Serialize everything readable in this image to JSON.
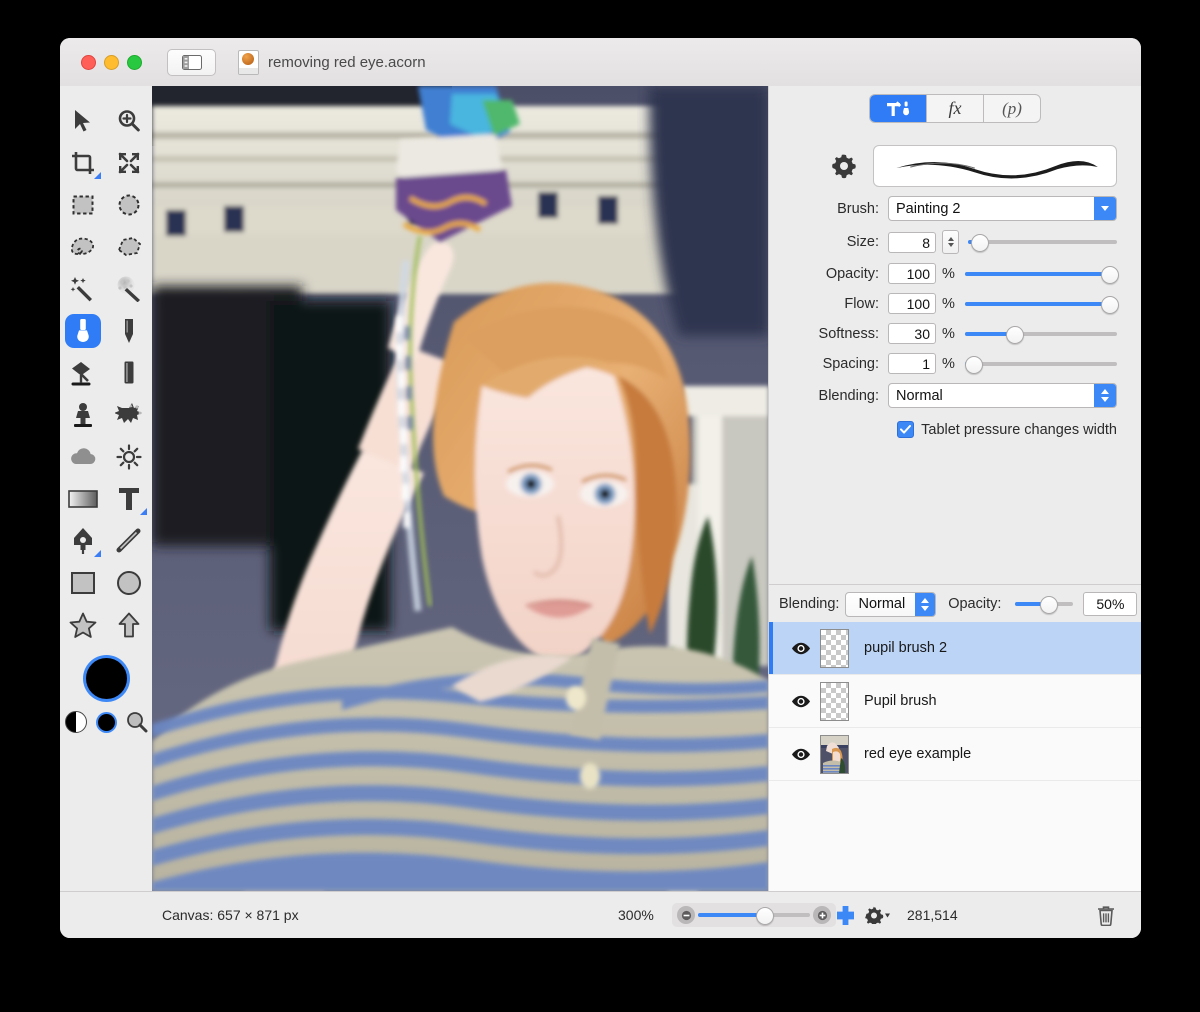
{
  "window": {
    "document_name": "removing red eye.acorn",
    "doc_icon": "acorn-document-icon",
    "sidebar_toggle_icon": "sidebar-toggle-icon",
    "traffic_lights": [
      "close-button",
      "minimize-button",
      "zoom-button"
    ]
  },
  "tools": {
    "items": [
      {
        "name": "move-tool",
        "icon": "arrow-cursor-icon",
        "selected": false,
        "has_corner": false
      },
      {
        "name": "zoom-tool",
        "icon": "magnifier-plus-icon",
        "selected": false,
        "has_corner": false
      },
      {
        "name": "crop-tool",
        "icon": "crop-icon",
        "selected": false,
        "has_corner": true
      },
      {
        "name": "transform-tool",
        "icon": "move-arrows-icon",
        "selected": false,
        "has_corner": false
      },
      {
        "name": "rectangular-select-tool",
        "icon": "marquee-rect-icon",
        "selected": false,
        "has_corner": false
      },
      {
        "name": "elliptical-select-tool",
        "icon": "marquee-ellipse-icon",
        "selected": false,
        "has_corner": false
      },
      {
        "name": "lasso-select-tool",
        "icon": "lasso-icon",
        "selected": false,
        "has_corner": false
      },
      {
        "name": "polygon-select-tool",
        "icon": "polygon-lasso-icon",
        "selected": false,
        "has_corner": false
      },
      {
        "name": "magic-wand-tool",
        "icon": "magic-wand-icon",
        "selected": false,
        "has_corner": false
      },
      {
        "name": "instant-alpha-tool",
        "icon": "instant-alpha-icon",
        "selected": false,
        "has_corner": false
      },
      {
        "name": "paintbrush-tool",
        "icon": "paintbrush-icon",
        "selected": true,
        "has_corner": false
      },
      {
        "name": "pencil-tool",
        "icon": "pencil-icon",
        "selected": false,
        "has_corner": false
      },
      {
        "name": "bucket-fill-tool",
        "icon": "paint-bucket-icon",
        "selected": false,
        "has_corner": false
      },
      {
        "name": "eraser-tool",
        "icon": "eraser-icon",
        "selected": false,
        "has_corner": false
      },
      {
        "name": "clone-stamp-tool",
        "icon": "clone-stamp-icon",
        "selected": false,
        "has_corner": false
      },
      {
        "name": "smudge-tool",
        "icon": "smudge-splat-icon",
        "selected": false,
        "has_corner": false
      },
      {
        "name": "blur-tool",
        "icon": "cloud-blur-icon",
        "selected": false,
        "has_corner": false
      },
      {
        "name": "dodge-burn-tool",
        "icon": "sun-dodge-icon",
        "selected": false,
        "has_corner": false
      },
      {
        "name": "gradient-tool",
        "icon": "gradient-icon",
        "selected": false,
        "has_corner": false
      },
      {
        "name": "text-tool",
        "icon": "text-t-icon",
        "selected": false,
        "has_corner": true
      },
      {
        "name": "bezier-pen-tool",
        "icon": "pen-nib-icon",
        "selected": false,
        "has_corner": true
      },
      {
        "name": "line-tool",
        "icon": "line-icon",
        "selected": false,
        "has_corner": false
      },
      {
        "name": "rectangle-shape-tool",
        "icon": "rectangle-icon",
        "selected": false,
        "has_corner": false
      },
      {
        "name": "ellipse-shape-tool",
        "icon": "ellipse-icon",
        "selected": false,
        "has_corner": false
      },
      {
        "name": "star-shape-tool",
        "icon": "star-icon",
        "selected": false,
        "has_corner": false
      },
      {
        "name": "arrow-shape-tool",
        "icon": "arrow-up-icon",
        "selected": false,
        "has_corner": false
      }
    ],
    "foreground_color": "#000000",
    "selection_ring_color": "#3d88f7"
  },
  "inspector": {
    "tabs": [
      {
        "name": "tools-tab",
        "label": "",
        "icon": "hammer-brush-icon",
        "active": true
      },
      {
        "name": "filters-tab",
        "label": "fx",
        "icon": "fx-icon",
        "active": false
      },
      {
        "name": "palettes-tab",
        "label": "(p)",
        "icon": "paren-p-icon",
        "active": false
      }
    ],
    "gear_icon": "gear-icon",
    "brush_preview": "brush-stroke-preview",
    "fields": {
      "brush_label": "Brush:",
      "brush_value": "Painting 2",
      "size_label": "Size:",
      "size_value": "8",
      "size_pct": "",
      "size_fill": 3,
      "opacity_label": "Opacity:",
      "opacity_value": "100",
      "opacity_pct": "%",
      "opacity_fill": 100,
      "flow_label": "Flow:",
      "flow_value": "100",
      "flow_pct": "%",
      "flow_fill": 100,
      "softness_label": "Softness:",
      "softness_value": "30",
      "softness_pct": "%",
      "softness_fill": 30,
      "spacing_label": "Spacing:",
      "spacing_value": "1",
      "spacing_pct": "%",
      "spacing_fill": 1,
      "blending_label": "Blending:",
      "blending_value": "Normal"
    },
    "tablet_checkbox": {
      "label": "Tablet pressure changes width",
      "checked": true
    }
  },
  "layers_panel": {
    "blending_label": "Blending:",
    "blending_value": "Normal",
    "opacity_label": "Opacity:",
    "opacity_value": "50%",
    "opacity_fill": 50,
    "layers": [
      {
        "name": "pupil brush 2",
        "visible": true,
        "selected": true,
        "thumb": "transparent-checker"
      },
      {
        "name": "Pupil brush",
        "visible": true,
        "selected": false,
        "thumb": "transparent-checker"
      },
      {
        "name": "red eye example",
        "visible": true,
        "selected": false,
        "thumb": "photo-thumbnail"
      }
    ]
  },
  "status_bar": {
    "canvas_info": "Canvas: 657 × 871 px",
    "zoom_level": "300%",
    "zoom_out_icon": "zoom-out-icon",
    "zoom_in_icon": "zoom-in-icon",
    "zoom_slider_fill": 58,
    "add_layer_icon": "add-layer-plus-icon",
    "layer_actions_icon": "gear-dropdown-icon",
    "memory_count": "281,514",
    "delete_icon": "trash-icon"
  },
  "canvas": {
    "image_description": "photo of a red-haired child holding a toy, striped shirt",
    "zoom": "300%"
  }
}
